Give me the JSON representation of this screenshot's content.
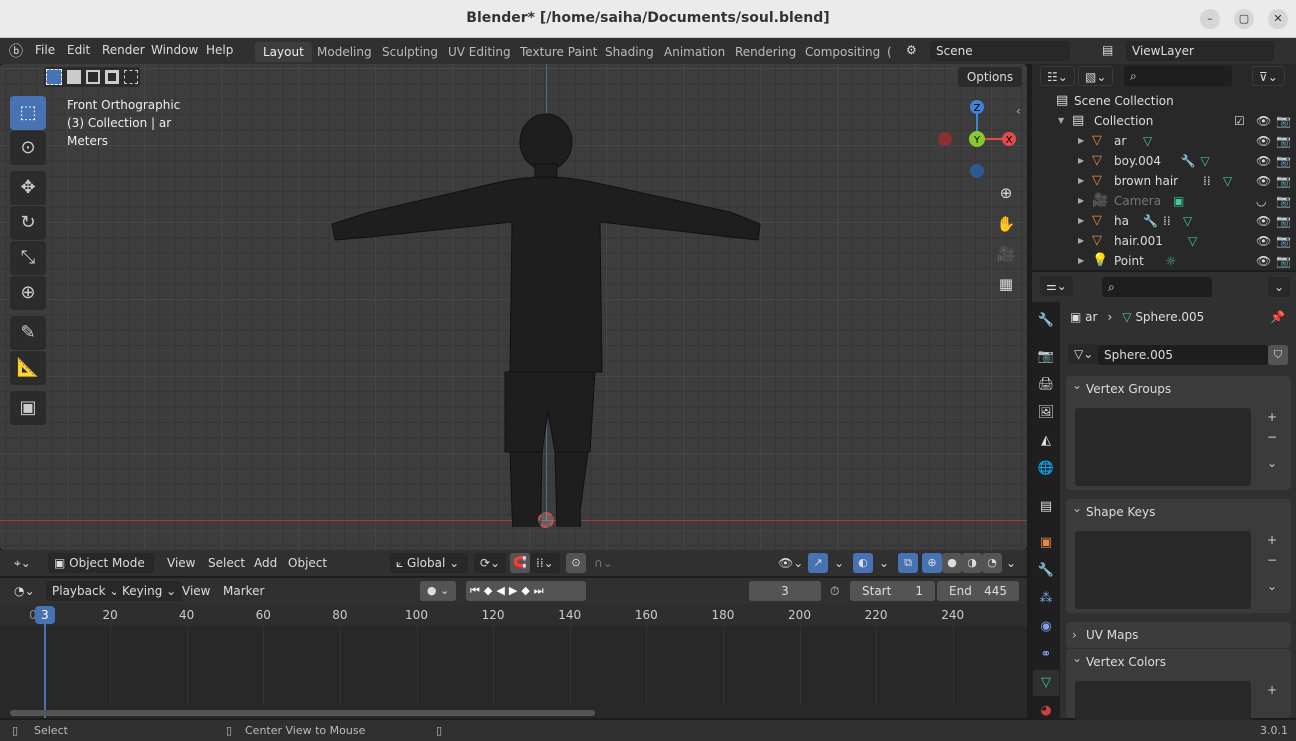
{
  "window": {
    "title": "Blender* [/home/saiha/Documents/soul.blend]",
    "minimize": "–",
    "maximize": "▢",
    "close": "✕"
  },
  "menu": [
    "File",
    "Edit",
    "Render",
    "Window",
    "Help"
  ],
  "workspaces": [
    "Layout",
    "Modeling",
    "Sculpting",
    "UV Editing",
    "Texture Paint",
    "Shading",
    "Animation",
    "Rendering",
    "Compositing",
    "("
  ],
  "scene": "Scene",
  "view_layer": "ViewLayer",
  "viewport": {
    "view_name": "Front Orthographic",
    "collection_info": "(3) Collection | ar",
    "units": "Meters",
    "options": "Options",
    "gizmo": {
      "z": "Z",
      "y": "Y",
      "x": "X"
    }
  },
  "viewport_header": {
    "mode": "Object Mode",
    "menus": [
      "View",
      "Select",
      "Add",
      "Object"
    ],
    "orientation": "Global"
  },
  "timeline": {
    "menus": [
      "Playback",
      "Keying",
      "View",
      "Marker"
    ],
    "current_frame": "3",
    "start_label": "Start",
    "start": "1",
    "end_label": "End",
    "end": "445",
    "ticks": [
      "20",
      "40",
      "60",
      "80",
      "100",
      "120",
      "140",
      "160",
      "180",
      "200",
      "220",
      "240"
    ],
    "cursor_frame": "3",
    "zero": "0"
  },
  "outliner": {
    "scene_collection": "Scene Collection",
    "collection": "Collection",
    "items": [
      {
        "name": "ar"
      },
      {
        "name": "boy.004"
      },
      {
        "name": "brown hair"
      },
      {
        "name": "Camera"
      },
      {
        "name": "ha"
      },
      {
        "name": "hair.001"
      },
      {
        "name": "Point"
      }
    ]
  },
  "properties": {
    "object": "ar",
    "mesh": "Sphere.005",
    "mesh_field": "Sphere.005",
    "panels": [
      "Vertex Groups",
      "Shape Keys",
      "UV Maps",
      "Vertex Colors"
    ]
  },
  "status": {
    "select": "Select",
    "center": "Center View to Mouse",
    "version": "3.0.1"
  },
  "colors": {
    "accent": "#4772b3",
    "mesh_orange": "#e3894a",
    "data_green": "#3cc9a0",
    "x_red": "#e34a4a",
    "y_green": "#8ac832",
    "z_blue": "#3d85d6"
  }
}
